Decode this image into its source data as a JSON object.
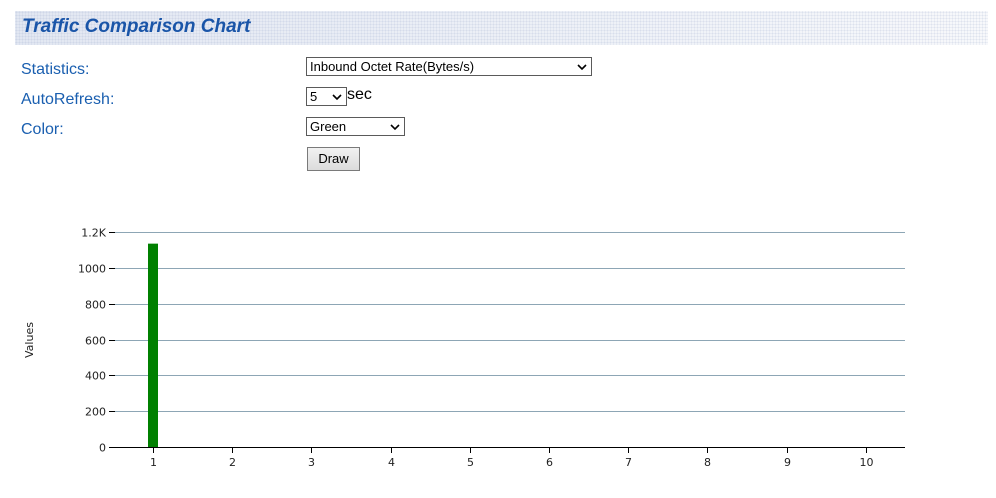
{
  "header": {
    "title": "Traffic Comparison Chart"
  },
  "form": {
    "statistics_label": "Statistics:",
    "statistics_value": "Inbound Octet Rate(Bytes/s)",
    "autorefresh_label": "AutoRefresh:",
    "autorefresh_value": "5",
    "autorefresh_unit": "sec",
    "color_label": "Color:",
    "color_value": "Green",
    "draw_label": "Draw"
  },
  "colors": {
    "bar": "#008000",
    "grid": "#8da6b5",
    "title": "#1a55a8",
    "label": "#1a5fb0"
  },
  "chart_data": {
    "type": "bar",
    "categories": [
      "1",
      "2",
      "3",
      "4",
      "5",
      "6",
      "7",
      "8",
      "9",
      "10"
    ],
    "values": [
      1135,
      0,
      0,
      0,
      0,
      0,
      0,
      0,
      0,
      0
    ],
    "ylabel": "Values",
    "ylim": [
      0,
      1200
    ],
    "yticks": [
      {
        "value": 0,
        "label": "0"
      },
      {
        "value": 200,
        "label": "200"
      },
      {
        "value": 400,
        "label": "400"
      },
      {
        "value": 600,
        "label": "600"
      },
      {
        "value": 800,
        "label": "800"
      },
      {
        "value": 1000,
        "label": "1000"
      },
      {
        "value": 1200,
        "label": "1.2K"
      }
    ],
    "grid": true
  }
}
